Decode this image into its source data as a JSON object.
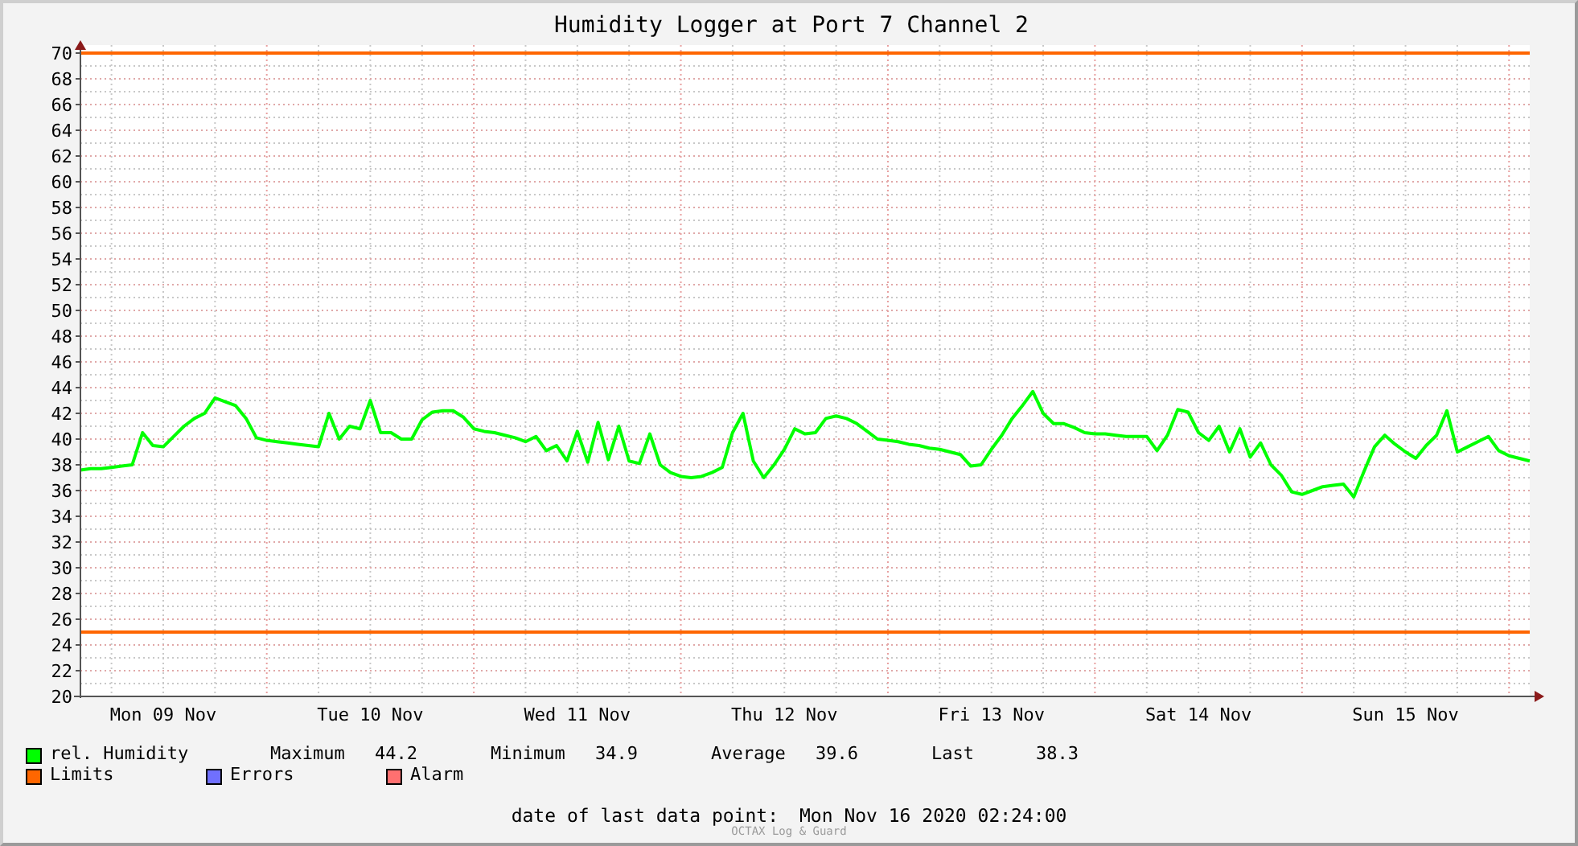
{
  "chart": {
    "chart_data": {
      "type": "line",
      "title": "Humidity Logger at Port 7 Channel 2",
      "categories": [
        null,
        null,
        null,
        null,
        null,
        null,
        null,
        null,
        "Mon 09 Nov",
        null,
        null,
        null,
        null,
        null,
        null,
        null,
        null,
        null,
        null,
        null,
        null,
        null,
        null,
        null,
        null,
        null,
        null,
        null,
        "Tue 10 Nov",
        null,
        null,
        null,
        null,
        null,
        null,
        null,
        null,
        null,
        null,
        null,
        null,
        null,
        null,
        null,
        null,
        null,
        null,
        null,
        "Wed 11 Nov",
        null,
        null,
        null,
        null,
        null,
        null,
        null,
        null,
        null,
        null,
        null,
        null,
        null,
        null,
        null,
        null,
        null,
        null,
        null,
        "Thu 12 Nov",
        null,
        null,
        null,
        null,
        null,
        null,
        null,
        null,
        null,
        null,
        null,
        null,
        null,
        null,
        null,
        null,
        null,
        null,
        null,
        "Fri 13 Nov",
        null,
        null,
        null,
        null,
        null,
        null,
        null,
        null,
        null,
        null,
        null,
        null,
        null,
        null,
        null,
        null,
        null,
        null,
        null,
        "Sat 14 Nov",
        null,
        null,
        null,
        null,
        null,
        null,
        null,
        null,
        null,
        null,
        null,
        null,
        null,
        null,
        null,
        null,
        null,
        null,
        null,
        "Sun 15 Nov",
        null,
        null,
        null,
        null,
        null,
        null,
        null,
        null,
        null,
        null,
        null,
        null
      ],
      "series": [
        {
          "name": "rel. Humidity",
          "color": "#00ff00",
          "values": [
            37.6,
            37.7,
            37.7,
            37.8,
            37.9,
            38,
            40.5,
            39.5,
            39.4,
            40.2,
            41,
            41.6,
            42,
            43.2,
            42.9,
            42.6,
            41.6,
            40.1,
            39.9,
            39.8,
            39.7,
            39.6,
            39.5,
            39.4,
            42,
            40,
            41,
            40.8,
            43,
            40.5,
            40.5,
            40,
            40,
            41.5,
            42.1,
            42.2,
            42.2,
            41.7,
            40.8,
            40.6,
            40.5,
            40.3,
            40.1,
            39.8,
            40.2,
            39.1,
            39.5,
            38.3,
            40.6,
            38.2,
            41.3,
            38.4,
            41,
            38.3,
            38.1,
            40.4,
            38,
            37.4,
            37.1,
            37,
            37.1,
            37.4,
            37.8,
            40.5,
            42,
            38.3,
            37,
            38,
            39.2,
            40.8,
            40.4,
            40.5,
            41.6,
            41.8,
            41.6,
            41.2,
            40.6,
            40,
            39.9,
            39.8,
            39.6,
            39.5,
            39.3,
            39.2,
            39,
            38.8,
            37.9,
            38,
            39.2,
            40.3,
            41.6,
            42.6,
            43.7,
            42,
            41.2,
            41.2,
            40.9,
            40.5,
            40.4,
            40.4,
            40.3,
            40.2,
            40.2,
            40.2,
            39.1,
            40.3,
            42.3,
            42.1,
            40.5,
            39.9,
            41,
            39,
            40.8,
            38.6,
            39.7,
            38,
            37.2,
            35.9,
            35.7,
            36,
            36.3,
            36.4,
            36.5,
            35.5,
            37.5,
            39.4,
            40.3,
            39.6,
            39,
            38.5,
            39.5,
            40.3,
            42.2,
            39,
            39.4,
            39.8,
            40.2,
            39.1,
            38.7,
            38.5,
            38.3
          ]
        }
      ],
      "ylim": [
        20,
        70
      ],
      "yticks": [
        20,
        22,
        24,
        26,
        28,
        30,
        32,
        34,
        36,
        38,
        40,
        42,
        44,
        46,
        48,
        50,
        52,
        54,
        56,
        58,
        60,
        62,
        64,
        66,
        68,
        70
      ],
      "grid": true,
      "ref_lines": [
        {
          "axis": "y",
          "value": 70,
          "color": "#ff6600"
        },
        {
          "axis": "y",
          "value": 25,
          "color": "#ff6600"
        }
      ]
    }
  },
  "legend": [
    {
      "label": "Limits",
      "color": "#ff6600"
    },
    {
      "label": "Errors",
      "color": "#7070ff"
    },
    {
      "label": "Alarm",
      "color": "#ff7070"
    }
  ],
  "stats": [
    {
      "label": "Maximum",
      "value": "44.2"
    },
    {
      "label": "Minimum",
      "value": "34.9"
    },
    {
      "label": "Average",
      "value": "39.6"
    },
    {
      "label": "Last",
      "value": "38.3"
    }
  ],
  "last_data_point": {
    "label": "date of last data point:",
    "value": "Mon Nov 16 2020 02:24:00"
  },
  "footer_credit": "OCTAX Log & Guard"
}
